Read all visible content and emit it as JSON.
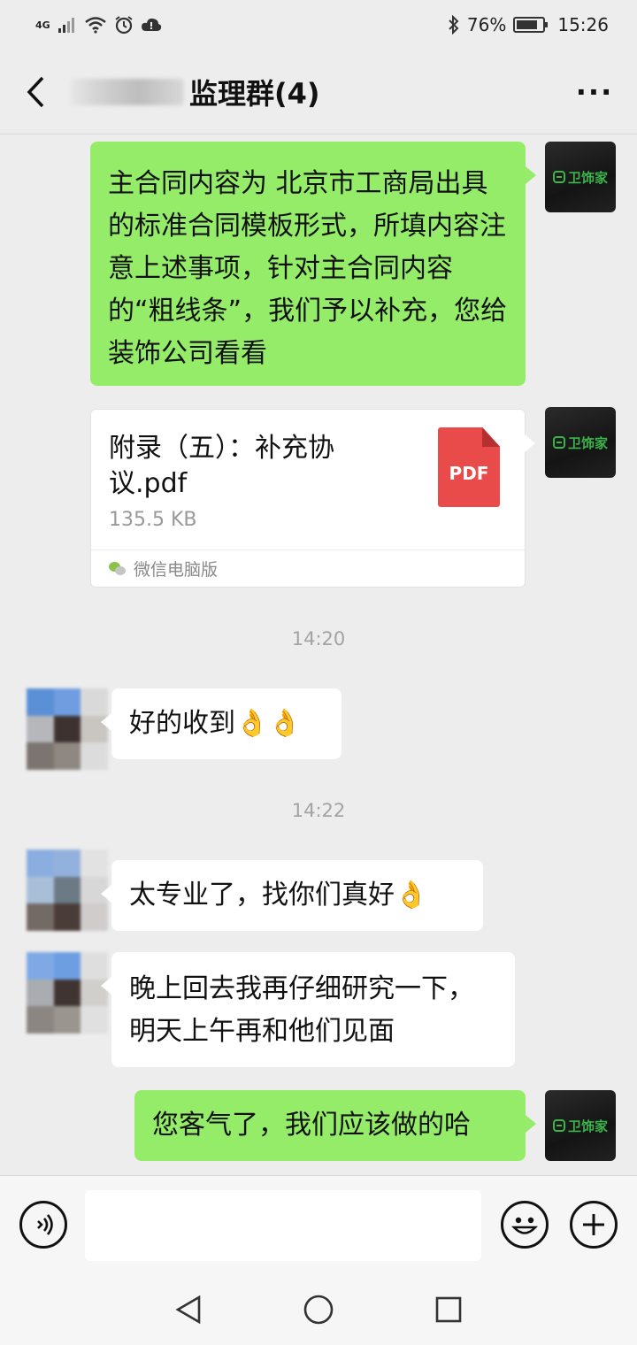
{
  "status_bar": {
    "network": "4G",
    "battery": "76%",
    "time": "15:26"
  },
  "header": {
    "title": "监理群(4)",
    "more": "···"
  },
  "messages": {
    "m1": "主合同内容为 北京市工商局出具的标准合同模板形式，所填内容注意上述事项，针对主合同内容的“粗线条”，我们予以补充，您给装饰公司看看",
    "file": {
      "name": "附录（五）：补充协议.pdf",
      "size": "135.5 KB",
      "icon_label": "PDF",
      "source": "微信电脑版"
    },
    "time1": "14:20",
    "m2": "好的收到",
    "m2_emoji": "👌👌",
    "time2": "14:22",
    "m3": "太专业了，找你们真好",
    "m3_emoji": "👌",
    "m4": "晚上回去我再仔细研究一下，明天上午再和他们见面",
    "m5": "您客气了，我们应该做的哈"
  },
  "brand": {
    "logo_text": "卫饰家",
    "color": "#39b54a"
  },
  "input": {
    "value": "",
    "placeholder": ""
  },
  "colors": {
    "sent_bubble": "#95ec69",
    "received_bubble": "#ffffff",
    "background": "#ededed"
  }
}
